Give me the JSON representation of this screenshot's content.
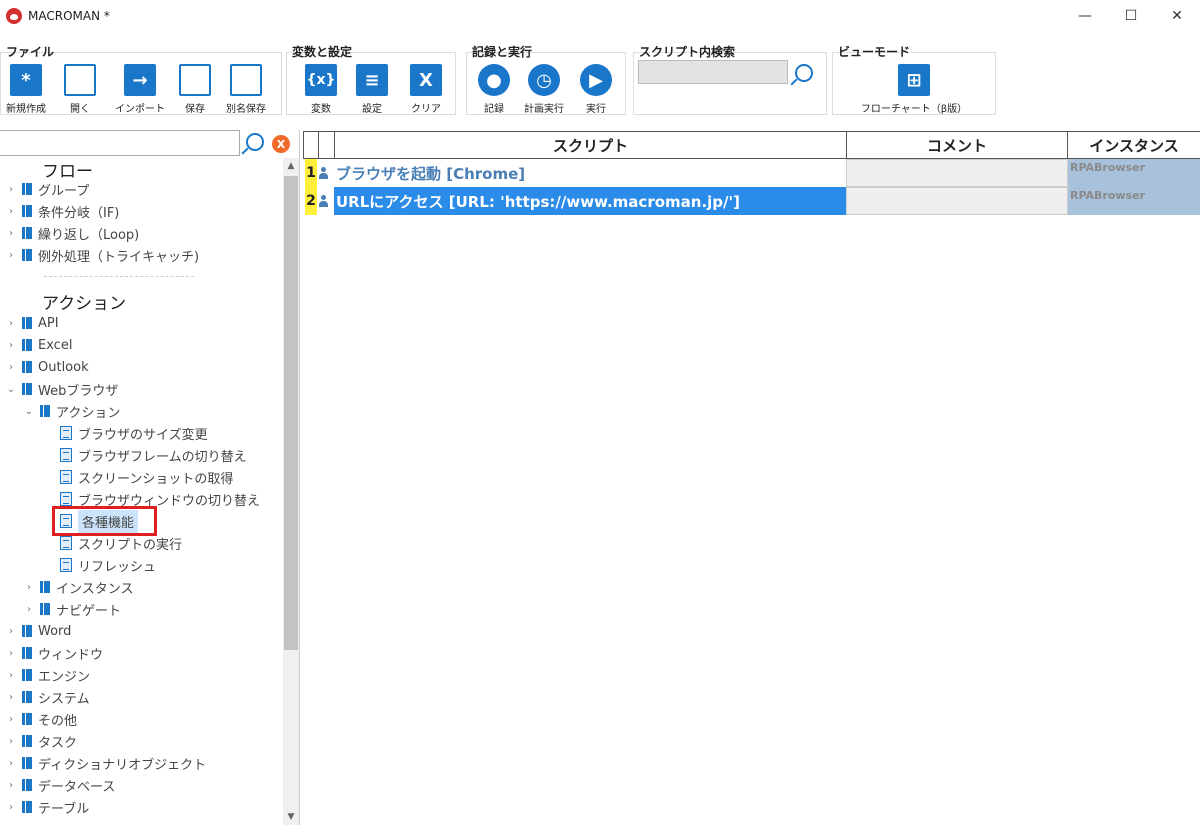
{
  "window": {
    "title": "MACROMAN *",
    "minimize": "—",
    "maximize": "☐",
    "close": "✕"
  },
  "ribbon": {
    "file": {
      "title": "ファイル",
      "buttons": [
        "新規作成",
        "開く",
        "インポート",
        "保存",
        "別名保存"
      ]
    },
    "vars": {
      "title": "変数と設定",
      "buttons": [
        "変数",
        "設定",
        "クリア"
      ]
    },
    "record": {
      "title": "記録と実行",
      "buttons": [
        "記録",
        "計画実行",
        "実行"
      ]
    },
    "search": {
      "title": "スクリプト内検索",
      "value": ""
    },
    "view": {
      "title": "ビューモード",
      "button": "フローチャート（β版）"
    },
    "icon_glyphs": {
      "new": "*",
      "vars": "{x}",
      "clear": "X",
      "import": "→"
    }
  },
  "tree": {
    "search_value": "",
    "clear_label": "X",
    "flow_header": "フロー",
    "flow_items": [
      "グループ",
      "条件分岐（IF)",
      "繰り返し（Loop)",
      "例外処理（トライキャッチ)"
    ],
    "action_header": "アクション",
    "action_items_top": [
      "API",
      "Excel",
      "Outlook"
    ],
    "web_browser": "Webブラウザ",
    "web_actions": "アクション",
    "web_action_children": [
      "ブラウザのサイズ変更",
      "ブラウザフレームの切り替え",
      "スクリーンショットの取得",
      "ブラウザウィンドウの切り替え",
      "各種機能",
      "スクリプトの実行",
      "リフレッシュ"
    ],
    "web_siblings": [
      "インスタンス",
      "ナビゲート"
    ],
    "action_items_bottom": [
      "Word",
      "ウィンドウ",
      "エンジン",
      "システム",
      "その他",
      "タスク",
      "ディクショナリオブジェクト",
      "データベース",
      "テーブル"
    ]
  },
  "grid": {
    "headers": {
      "script": "スクリプト",
      "comment": "コメント",
      "instance": "インスタンス"
    },
    "rows": [
      {
        "num": "1",
        "script": "ブラウザを起動 [Chrome]",
        "comment": "",
        "instance": "RPABrowser"
      },
      {
        "num": "2",
        "script": "URLにアクセス [URL: 'https://www.macroman.jp/']",
        "comment": "",
        "instance": "RPABrowser"
      }
    ]
  },
  "colors": {
    "accent": "#1976c8",
    "row_num": "#ffef3a",
    "selected": "#2b8be8",
    "highlight_box": "#e02020",
    "instance_bg": "#a9c2dc"
  }
}
